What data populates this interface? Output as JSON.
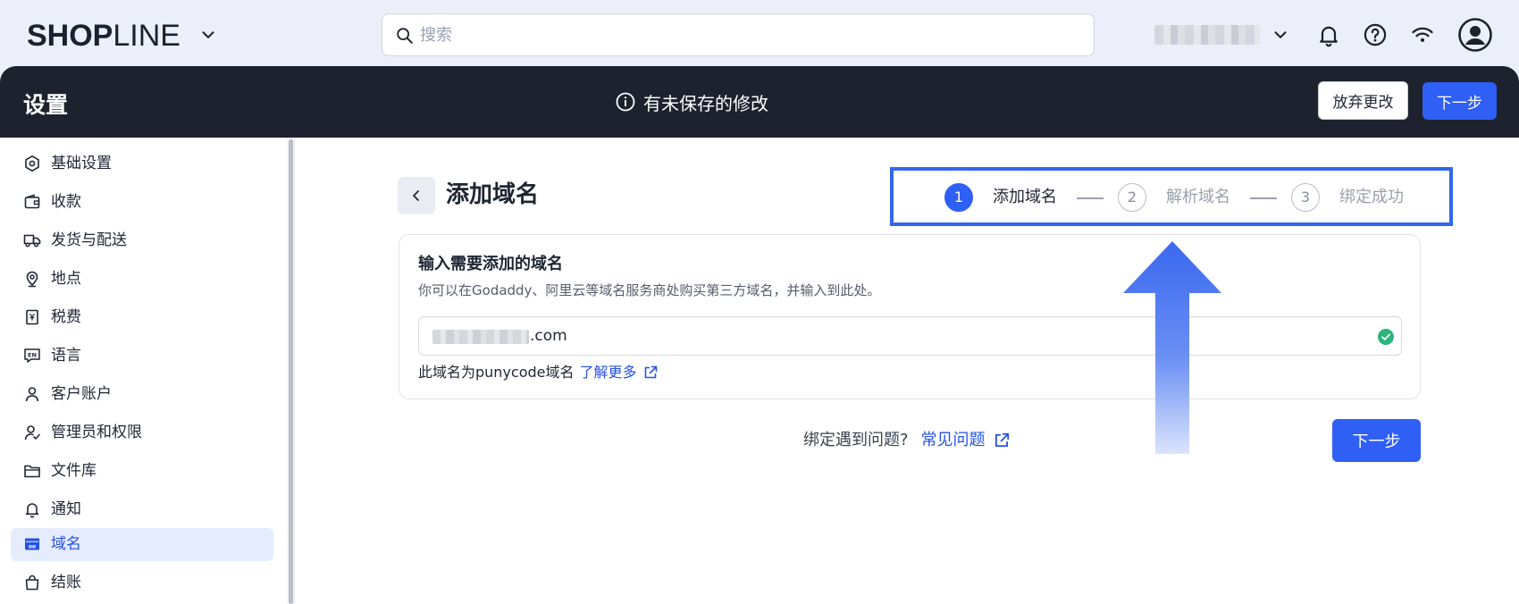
{
  "app": {
    "brand_bold": "SHOP",
    "brand_thin": "LINE"
  },
  "topbar": {
    "search_placeholder": "搜索"
  },
  "header": {
    "title": "设置",
    "unsaved_notice": "有未保存的修改",
    "discard_label": "放弃更改",
    "next_label": "下一步"
  },
  "sidebar": {
    "items": [
      {
        "label": "基础设置",
        "icon": "hexagon-gear-icon"
      },
      {
        "label": "收款",
        "icon": "wallet-icon"
      },
      {
        "label": "发货与配送",
        "icon": "truck-icon"
      },
      {
        "label": "地点",
        "icon": "location-pin-icon"
      },
      {
        "label": "税费",
        "icon": "receipt-icon"
      },
      {
        "label": "语言",
        "icon": "language-en-icon"
      },
      {
        "label": "客户账户",
        "icon": "user-icon"
      },
      {
        "label": "管理员和权限",
        "icon": "user-admin-icon"
      },
      {
        "label": "文件库",
        "icon": "folder-icon"
      },
      {
        "label": "通知",
        "icon": "bell-icon"
      },
      {
        "label": "域名",
        "icon": "domain-icon",
        "active": true
      },
      {
        "label": "结账",
        "icon": "shopping-bag-icon"
      }
    ]
  },
  "main": {
    "page_title": "添加域名",
    "steps": [
      {
        "number": "1",
        "label": "添加域名",
        "active": true
      },
      {
        "number": "2",
        "label": "解析域名",
        "active": false
      },
      {
        "number": "3",
        "label": "绑定成功",
        "active": false
      }
    ],
    "card": {
      "title": "输入需要添加的域名",
      "description": "你可以在Godaddy、阿里云等域名服务商处购买第三方域名，并输入到此处。",
      "domain_suffix": ".com",
      "punycode_note": "此域名为punycode域名",
      "learn_more": "了解更多"
    },
    "help_text": "绑定遇到问题?",
    "faq_link": "常见问题",
    "next_label": "下一步"
  },
  "colors": {
    "primary": "#2f5ff5",
    "header_bg": "#1e222e",
    "topbar_bg": "#eceff9",
    "success": "#2db47a",
    "annotation": "#3366ee"
  }
}
